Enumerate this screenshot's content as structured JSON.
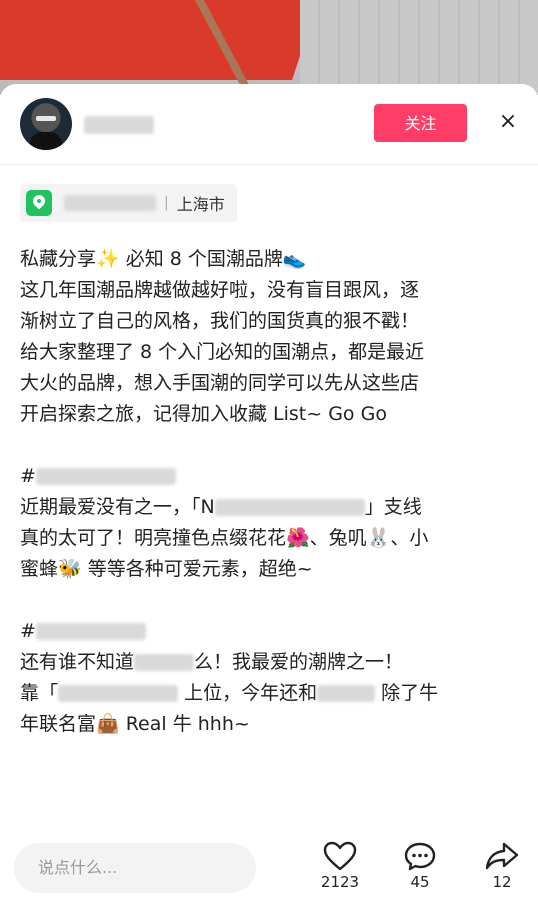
{
  "header": {
    "follow_label": "关注",
    "close_glyph": "×"
  },
  "location": {
    "city": "上海市",
    "separator": "|"
  },
  "post": {
    "lines": [
      "私藏分享✨ 必知 8 个国潮品牌👟",
      "这几年国潮品牌越做越好啦，没有盲目跟风，逐",
      "渐树立了自己的风格，我们的国货真的狠不戳！",
      "给大家整理了 8 个入门必知的国潮点，都是最近",
      "大火的品牌，想入手国潮的同学可以先从这些店",
      "开启探索之旅，记得加入收藏 List~ Go Go"
    ],
    "sec1": {
      "hash": "#",
      "line1_a": "近期最爱没有之一，「N",
      "line1_b": "」支线",
      "line2": "真的太可了！明亮撞色点缀花花🌺、兔叽🐰、小",
      "line3": "蜜蜂🐝 等等各种可爱元素，超绝~"
    },
    "sec2": {
      "hash": "#",
      "line1_a": "还有谁不知道",
      "line1_b": "么！我最爱的潮牌之一！",
      "line2_a": "靠「",
      "line2_b": "上位，今年还和",
      "line2_c": "除了牛",
      "line3": "年联名富👜 Real 牛 hhh~"
    }
  },
  "bottom_bar": {
    "comment_placeholder": "说点什么...",
    "likes": "2123",
    "comments": "45",
    "shares": "12"
  },
  "colors": {
    "follow_bg": "#ff3d67",
    "location_pin": "#22c35e"
  }
}
